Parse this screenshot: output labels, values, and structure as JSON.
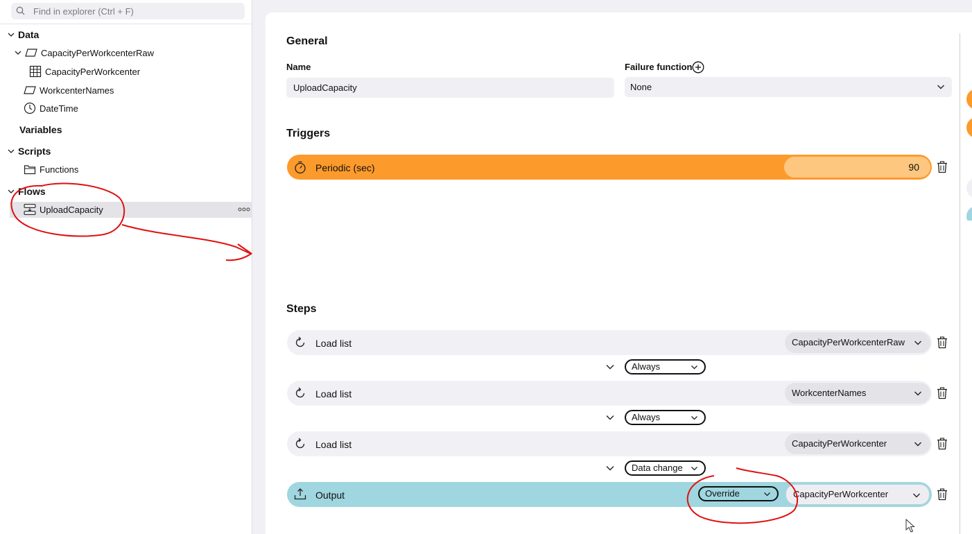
{
  "explorer": {
    "search_placeholder": "Find in explorer (Ctrl + F)",
    "sections": {
      "data": "Data",
      "variables": "Variables",
      "scripts": "Scripts",
      "flows": "Flows"
    },
    "items": {
      "capacity_raw": "CapacityPerWorkcenterRaw",
      "capacity": "CapacityPerWorkcenter",
      "workcenter_names": "WorkcenterNames",
      "datetime": "DateTime",
      "functions": "Functions",
      "upload_capacity": "UploadCapacity"
    }
  },
  "general": {
    "heading": "General",
    "name_label": "Name",
    "name_value": "UploadCapacity",
    "failure_label": "Failure function",
    "failure_value": "None"
  },
  "triggers": {
    "heading": "Triggers",
    "periodic_label": "Periodic (sec)",
    "periodic_value": "90"
  },
  "steps": {
    "heading": "Steps",
    "list": [
      {
        "title": "Load list",
        "target": "CapacityPerWorkcenterRaw"
      },
      {
        "title": "Load list",
        "target": "WorkcenterNames"
      },
      {
        "title": "Load list",
        "target": "CapacityPerWorkcenter"
      },
      {
        "title": "Output",
        "mode": "Override",
        "target": "CapacityPerWorkcenter"
      }
    ],
    "conditions": [
      "Always",
      "Always",
      "Data change"
    ]
  },
  "colors": {
    "trigger": "#fd9a2c",
    "trigger_value_bg": "#fdc77f",
    "output": "#9fd6df",
    "annotation": "#e01010"
  }
}
